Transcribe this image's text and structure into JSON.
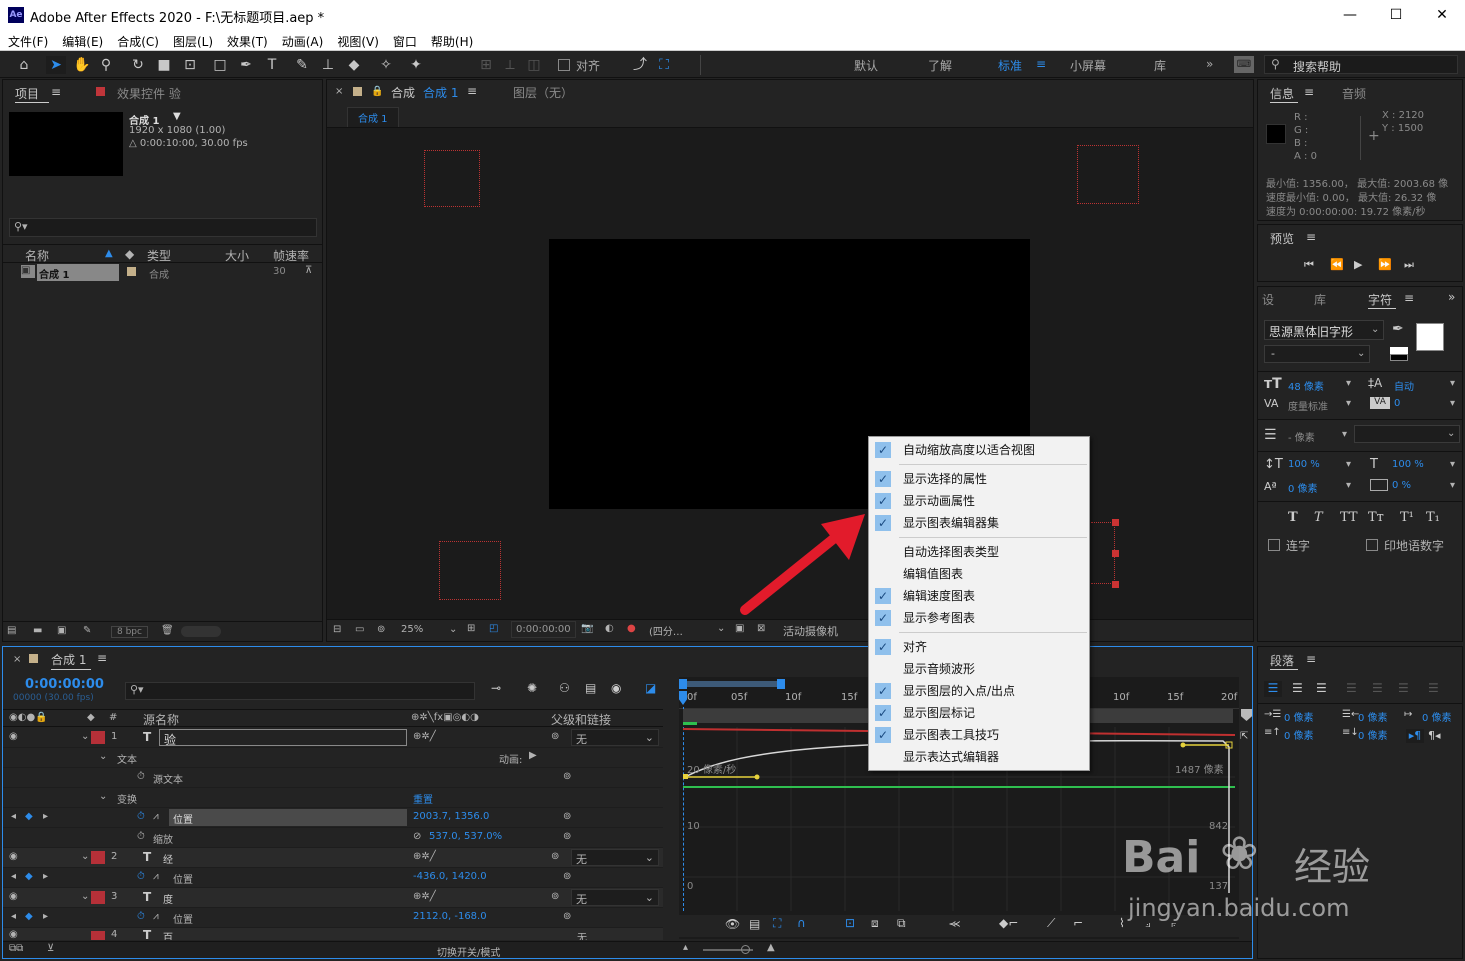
{
  "window": {
    "title": "Adobe After Effects 2020 - F:\\无标题项目.aep *",
    "logo": "Ae"
  },
  "menu": [
    "文件(F)",
    "编辑(E)",
    "合成(C)",
    "图层(L)",
    "效果(T)",
    "动画(A)",
    "视图(V)",
    "窗口",
    "帮助(H)"
  ],
  "toolbar": {
    "align": "对齐",
    "workspaces": [
      "默认",
      "了解",
      "标准",
      "小屏幕",
      "库"
    ],
    "active_ws": "标准",
    "search": "搜索帮助"
  },
  "project": {
    "tab": "项目",
    "tab2": "效果控件 验",
    "comp_name": "合成 1",
    "res": "1920 x 1080 (1.00)",
    "dur": "△ 0:00:10:00, 30.00 fps",
    "cols": [
      "名称",
      "类型",
      "大小",
      "帧速率"
    ],
    "item": {
      "name": "合成 1",
      "type": "合成",
      "fps": "30"
    },
    "bpc": "8 bpc"
  },
  "comp": {
    "tab": "合成",
    "tab_name": "合成 1",
    "layer_tab": "图层（无）",
    "subtab": "合成 1",
    "zoom": "25%",
    "time": "0:00:00:00",
    "view": "(四分…",
    "camera": "活动摄像机"
  },
  "info": {
    "tab": "信息",
    "tab2": "音频",
    "r": "R :",
    "g": "G :",
    "b": "B :",
    "a": "A :  0",
    "x": "X : 2120",
    "y": "Y : 1500",
    "line1": "最小值: 1356.00，  最大值: 2003.68 像",
    "line2": "速度最小值: 0.00，  最大值: 26.32 像",
    "line3": "速度为 0:00:00:00:  19.72 像素/秒"
  },
  "preview": {
    "tab": "预览"
  },
  "char": {
    "tab1": "设",
    "tab2": "库",
    "tab3": "字符",
    "font": "思源黑体旧字形",
    "style": "-",
    "size": "48 像素",
    "leading": "自动",
    "kern": "度量标准",
    "track": "0",
    "stroke": "- 像素",
    "vscale": "100 %",
    "hscale": "100 %",
    "baseline": "0 像素",
    "tsume": "0 %",
    "styles": [
      "T",
      "T",
      "TT",
      "Tт",
      "T¹",
      "T₁"
    ],
    "ligature": "连字",
    "hindi": "印地语数字"
  },
  "para": {
    "tab": "段落",
    "v1": "0 像素",
    "v2": "0 像素",
    "v3": "0 像素",
    "v4": "0 像素",
    "v5": "0 像素"
  },
  "timeline": {
    "tab": "合成 1",
    "timecode": "0:00:00:00",
    "fps": "00000 (30.00 fps)",
    "col_src": "源名称",
    "col_parent": "父级和链接",
    "animate": "动画:",
    "layers": [
      {
        "n": "1",
        "name": "验",
        "parent": "无"
      },
      {
        "n": "2",
        "name": "经",
        "parent": "无"
      },
      {
        "n": "3",
        "name": "度",
        "parent": "无"
      },
      {
        "n": "4",
        "name": "百",
        "parent": "无"
      }
    ],
    "text_grp": "文本",
    "src_text": "源文本",
    "transform": "变换",
    "reset": "重置",
    "pos": "位置",
    "scale": "缩放",
    "pos1": "2003.7, 1356.0",
    "scale1": "537.0, 537.0%",
    "pos2": "-436.0, 1420.0",
    "pos3": "2112.0, -168.0",
    "ruler": [
      "0f",
      "05f",
      "10f",
      "15f",
      "10f",
      "15f",
      "20f"
    ],
    "graph": {
      "l1": "20 像素/秒",
      "r1": "1487 像素",
      "l2": "10",
      "r2": "842",
      "l3": "0",
      "r3": "137"
    },
    "toggle": "切换开关/模式"
  },
  "context_menu": [
    {
      "label": "自动缩放高度以适合视图",
      "checked": true
    },
    {
      "label": "显示选择的属性",
      "checked": true
    },
    {
      "label": "显示动画属性",
      "checked": true
    },
    {
      "label": "显示图表编辑器集",
      "checked": true
    },
    {
      "label": "自动选择图表类型",
      "checked": false
    },
    {
      "label": "编辑值图表",
      "checked": false
    },
    {
      "label": "编辑速度图表",
      "checked": true
    },
    {
      "label": "显示参考图表",
      "checked": true
    },
    {
      "label": "对齐",
      "checked": true
    },
    {
      "label": "显示音频波形",
      "checked": false
    },
    {
      "label": "显示图层的入点/出点",
      "checked": true
    },
    {
      "label": "显示图层标记",
      "checked": true
    },
    {
      "label": "显示图表工具技巧",
      "checked": true
    },
    {
      "label": "显示表达式编辑器",
      "checked": false
    }
  ],
  "watermark": {
    "brand": "Bai",
    "brand2": "经验",
    "url": "jingyan.baidu.com"
  }
}
